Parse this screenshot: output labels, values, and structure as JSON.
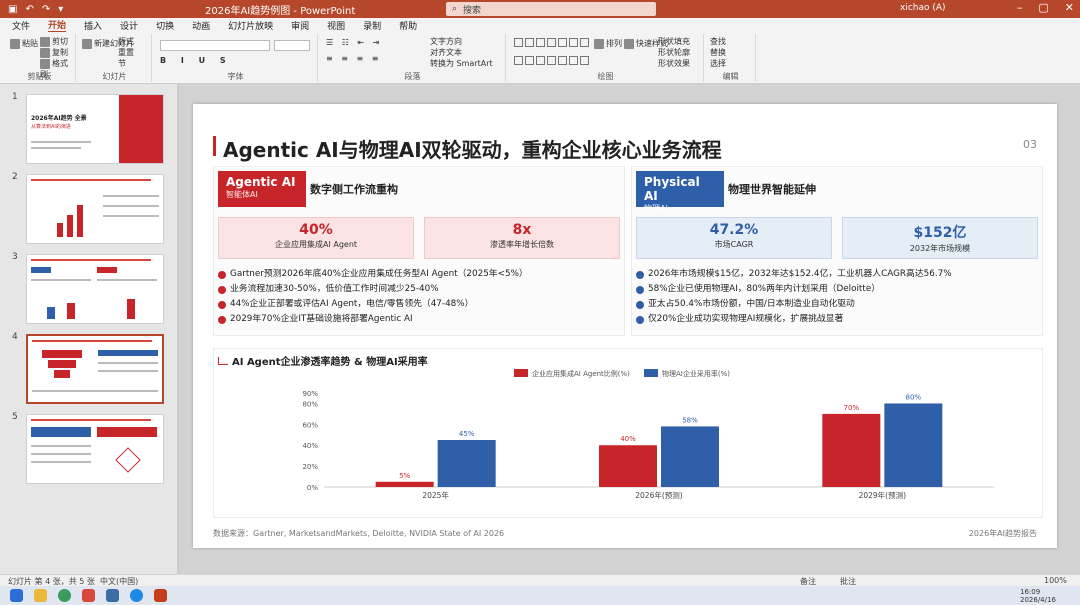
{
  "app": {
    "doc_title": "2026年AI趋势例图 - PowerPoint",
    "search_placeholder": "搜索",
    "user": "xichao (A)"
  },
  "ribbon": {
    "tabs": [
      "文件",
      "开始",
      "插入",
      "设计",
      "切换",
      "动画",
      "幻灯片放映",
      "审阅",
      "视图",
      "录制",
      "帮助"
    ],
    "active_tab": "开始",
    "groups": {
      "clipboard": "剪贴板",
      "slides": "幻灯片",
      "font": "字体",
      "paragraph": "段落",
      "drawing": "绘图",
      "editing": "编辑"
    },
    "labels": {
      "paste": "粘贴",
      "cut": "剪切",
      "copy": "复制",
      "format_painter": "格式刷",
      "new_slide": "新建幻灯片",
      "layout": "版式",
      "reset": "重置",
      "section": "节",
      "text_direction": "文字方向",
      "align_text": "对齐文本",
      "smartart": "转换为 SmartArt",
      "arrange": "排列",
      "quick_styles": "快速样式",
      "shape_fill": "形状填充",
      "shape_outline": "形状轮廓",
      "shape_effects": "形状效果",
      "find": "查找",
      "replace": "替换",
      "select": "选择"
    }
  },
  "thumbnails": {
    "nums": [
      "1",
      "2",
      "3",
      "4",
      "5"
    ],
    "slide1_title": "2026年AI趋势 全景",
    "slide1_sub": "从算法到AI的演进"
  },
  "slide": {
    "title": "Agentic AI与物理AI双轮驱动，重构企业核心业务流程",
    "page_num": "03",
    "left": {
      "badge": "Agentic AI",
      "badge_sub": "智能体AI",
      "subtitle": "数字侧工作流重构",
      "stats": [
        {
          "value": "40%",
          "label": "企业应用集成AI Agent"
        },
        {
          "value": "8x",
          "label": "渗透率年增长倍数"
        }
      ],
      "bullets": [
        "Gartner预测2026年底40%企业应用集成任务型AI Agent（2025年<5%）",
        "业务流程加速30-50%，低价值工作时间减少25-40%",
        "44%企业正部署或评估AI Agent，电信/零售领先（47-48%）",
        "2029年70%企业IT基础设施将部署Agentic AI"
      ]
    },
    "right": {
      "badge": "Physical AI",
      "badge_sub": "物理AI",
      "subtitle": "物理世界智能延伸",
      "stats": [
        {
          "value": "47.2%",
          "label": "市场CAGR"
        },
        {
          "value": "$152亿",
          "label": "2032年市场规模"
        }
      ],
      "bullets": [
        "2026年市场规模$15亿，2032年达$152.4亿，工业机器人CAGR高达56.7%",
        "58%企业已使用物理AI，80%两年内计划采用（Deloitte）",
        "亚太占50.4%市场份额，中国/日本制造业自动化驱动",
        "仅20%企业成功实现物理AI规模化，扩展挑战显著"
      ]
    },
    "footer_source": "数据来源：Gartner, MarketsandMarkets, Deloitte, NVIDIA State of AI 2026",
    "footer_brand": "2026年AI趋势报告"
  },
  "chart_data": {
    "type": "bar",
    "title": "AI Agent企业渗透率趋势 & 物理AI采用率",
    "categories": [
      "2025年",
      "2026年(预测)",
      "2029年(预测)"
    ],
    "series": [
      {
        "name": "企业应用集成AI Agent比例(%)",
        "values": [
          5,
          40,
          70
        ],
        "color": "#c8252b"
      },
      {
        "name": "物理AI企业采用率(%)",
        "values": [
          45,
          58,
          80
        ],
        "color": "#2f5fa8"
      }
    ],
    "yticks": [
      "0%",
      "20%",
      "40%",
      "60%",
      "80%",
      "90%"
    ],
    "ylim": [
      0,
      90
    ],
    "grid": false,
    "legend": "top-center"
  },
  "statusbar": {
    "slide_info": "幻灯片 第 4 张，共 5 张",
    "language": "中文(中国)",
    "notes": "备注",
    "comments": "批注",
    "zoom": "100%"
  },
  "taskbar": {
    "time": "16:09",
    "date": "2026/4/16"
  }
}
